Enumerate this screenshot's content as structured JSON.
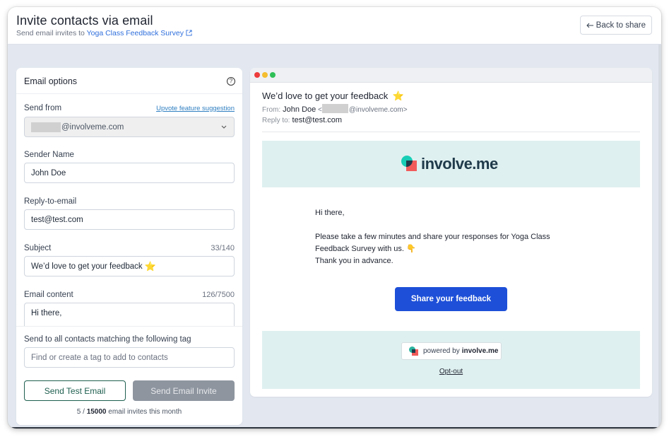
{
  "header": {
    "title": "Invite contacts via email",
    "subtitle_prefix": "Send email invites to ",
    "survey_link": "Yoga Class Feedback Survey",
    "back_button": "Back to share",
    "back_icon": "arrow-left-icon",
    "external_icon": "external-link-icon"
  },
  "email_options": {
    "title": "Email options",
    "help_icon": "?",
    "send_from": {
      "label": "Send from",
      "upvote_link": "Upvote feature suggestion",
      "value_domain": "@involveme.com"
    },
    "sender_name": {
      "label": "Sender Name",
      "value": "John Doe"
    },
    "reply_to": {
      "label": "Reply-to-email",
      "value": "test@test.com"
    },
    "subject": {
      "label": "Subject",
      "counter": "33/140",
      "value": "We’d love to get your feedback",
      "emoji": "⭐"
    },
    "content": {
      "label": "Email content",
      "counter": "126/7500",
      "value": "Hi there,"
    },
    "tag": {
      "label": "Send to all contacts matching the following tag",
      "placeholder": "Find or create a tag to add to contacts"
    },
    "send_test_button": "Send Test Email",
    "send_invite_button": "Send Email Invite",
    "quota": {
      "used": "5",
      "sep": " / ",
      "limit": "15000",
      "suffix": " email invites this month"
    }
  },
  "preview": {
    "subject": "We’d love to get your feedback",
    "subject_emoji": "⭐",
    "from_label": "From:",
    "from_name": "John Doe",
    "from_open": " <",
    "from_domain": "@involveme.com>",
    "reply_label": "Reply to:",
    "reply_value": "test@test.com",
    "logo_text": "involve.me",
    "body": {
      "greeting": "Hi there,",
      "line1": "Please take a few minutes and share your responses for Yoga Class",
      "line2": "Feedback Survey with us.",
      "line2_emoji": "👇",
      "line3": "Thank you in advance."
    },
    "cta": "Share your feedback",
    "powered_prefix": "powered by",
    "powered_brand": "involve.me",
    "optout": "Opt-out"
  },
  "colors": {
    "link": "#2f6fdc",
    "cta": "#1d4fd8",
    "outline_button": "#1f5f4f",
    "disabled_button": "#8e959f",
    "banner": "#dff0f0"
  }
}
